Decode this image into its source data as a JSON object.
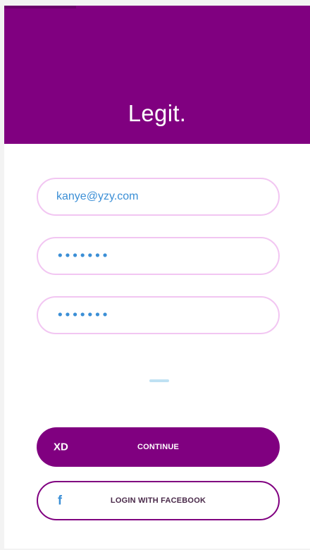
{
  "app": {
    "brand": "Legit."
  },
  "form": {
    "email": {
      "value": "kanye@yzy.com"
    },
    "password": {
      "masked": "•••••••"
    },
    "confirm_password": {
      "masked": "•••••••"
    }
  },
  "actions": {
    "continue": {
      "prefix": "XD",
      "label": "CONTINUE"
    },
    "facebook": {
      "icon_glyph": "f",
      "icon_name": "facebook-icon",
      "label": "LOGIN WITH FACEBOOK"
    }
  },
  "colors": {
    "brand_purple": "#800080",
    "field_border": "#f2c6f2",
    "accent_blue": "#3b8fd6",
    "divider": "#bfe1f3"
  }
}
